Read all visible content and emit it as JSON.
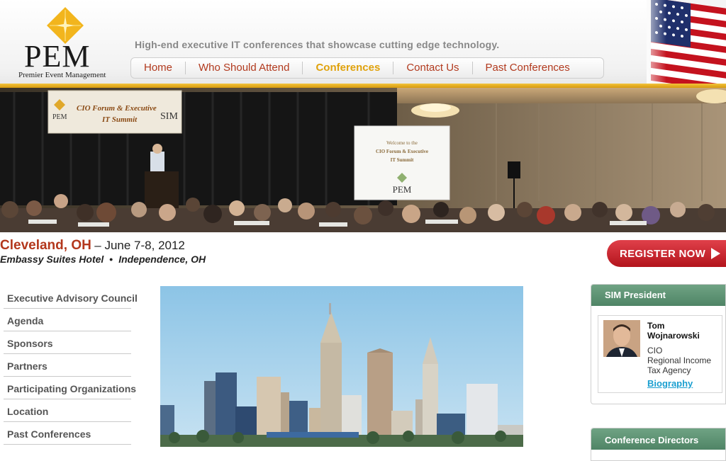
{
  "logo": {
    "text": "PEM",
    "subtitle": "Premier Event Management"
  },
  "header": {
    "tagline": "High-end executive IT conferences that showcase cutting edge technology."
  },
  "nav": {
    "items": [
      {
        "label": "Home"
      },
      {
        "label": "Who Should Attend"
      },
      {
        "label": "Conferences"
      },
      {
        "label": "Contact Us"
      },
      {
        "label": "Past Conferences"
      }
    ],
    "active": "Conferences"
  },
  "hero": {
    "banner_line1": "CIO Forum & Executive",
    "banner_line2": "IT Summit",
    "screen_line1": "Welcome to the",
    "screen_line2": "CIO Forum & Executive",
    "screen_line3": "IT Summit"
  },
  "event": {
    "city": "Cleveland, OH",
    "date": "– June 7-8, 2012",
    "venue": "Embassy Suites Hotel",
    "venue_sep": "•",
    "location": "Independence, OH"
  },
  "register": {
    "label": "REGISTER NOW"
  },
  "left_menu": {
    "items": [
      {
        "label": "Executive Advisory Council"
      },
      {
        "label": "Agenda"
      },
      {
        "label": "Sponsors"
      },
      {
        "label": "Partners"
      },
      {
        "label": "Participating Organizations"
      },
      {
        "label": "Location"
      },
      {
        "label": "Past Conferences"
      }
    ]
  },
  "sim_president": {
    "heading": "SIM President",
    "name_line1": "Tom",
    "name_line2": "Wojnarowski",
    "title_line1": "CIO",
    "title_line2": "Regional Income",
    "title_line3": "Tax Agency",
    "bio_link": "Biography"
  },
  "directors": {
    "heading": "Conference Directors"
  },
  "colors": {
    "accent_red": "#b3371c",
    "nav_active": "#e0a20c",
    "gold_bar": "#f2c33c",
    "box_green": "#5b8f71",
    "link_blue": "#1a9fd0"
  }
}
